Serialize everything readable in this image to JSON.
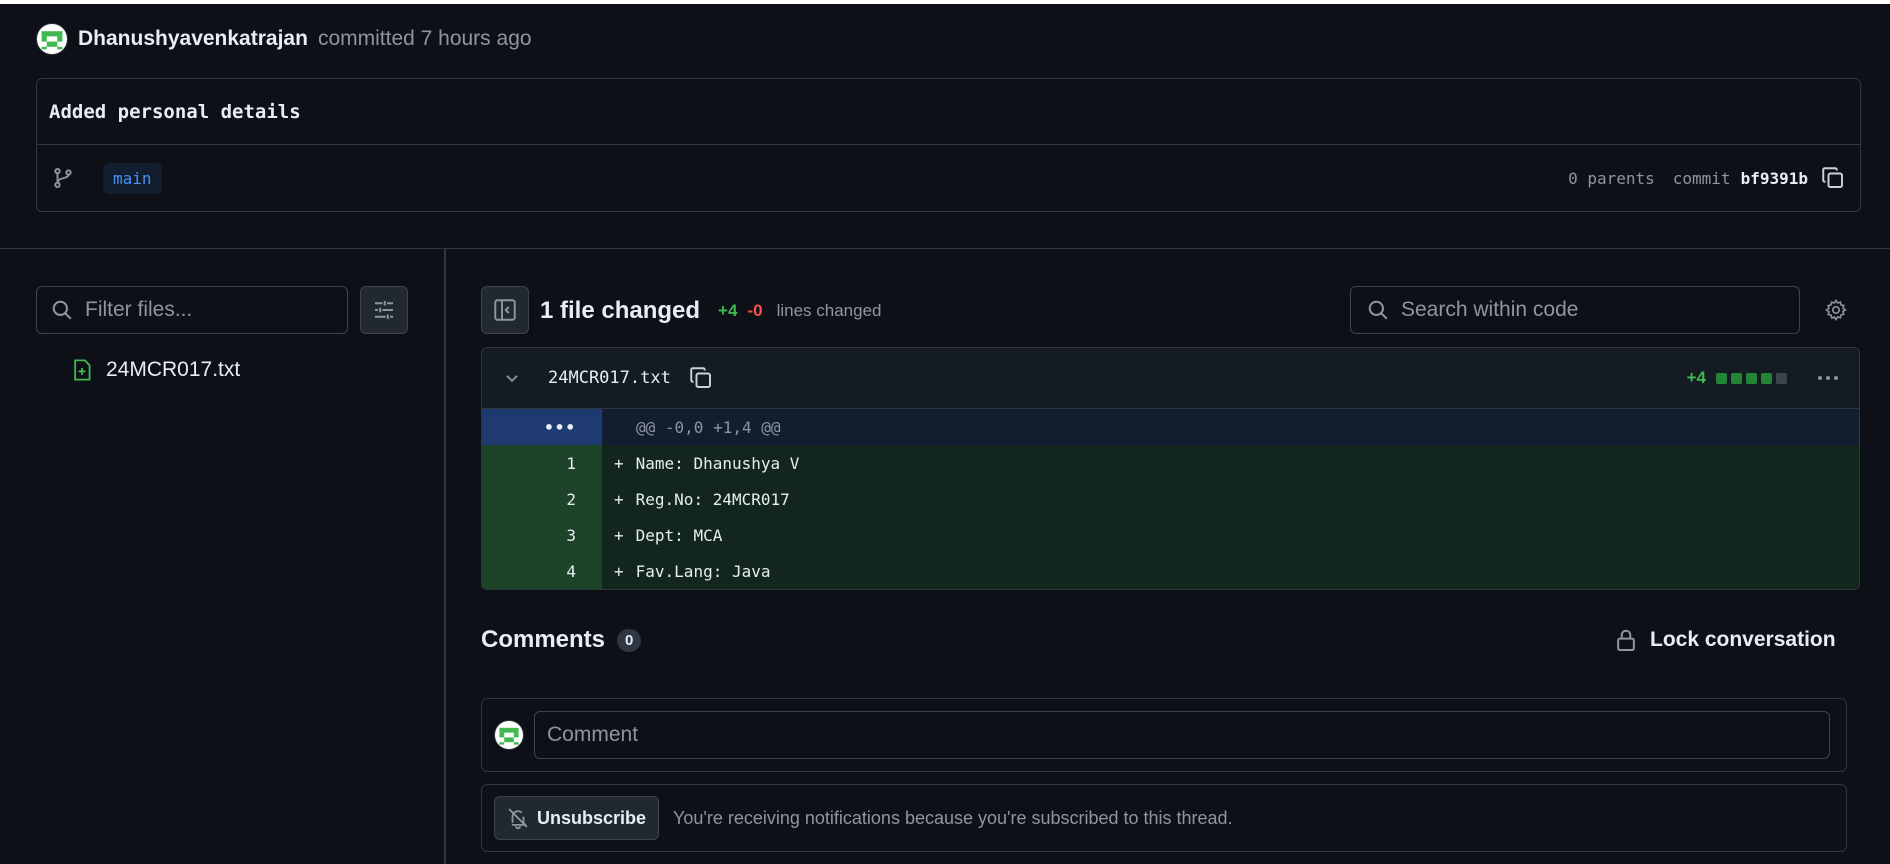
{
  "commit": {
    "author": "Dhanushyavenkatrajan",
    "meta": "committed 7 hours ago",
    "message": "Added personal details",
    "branch": "main",
    "parents": "0 parents",
    "commit_label": "commit",
    "sha": "bf9391b"
  },
  "sidebar": {
    "filter_placeholder": "Filter files...",
    "files": [
      {
        "name": "24MCR017.txt",
        "status": "added"
      }
    ]
  },
  "summary": {
    "files_changed": "1 file changed",
    "additions": "+4",
    "deletions": "-0",
    "lines_changed": "lines changed",
    "search_placeholder": "Search within code"
  },
  "diff": {
    "filename": "24MCR017.txt",
    "stat_additions": "+4",
    "hunk_marker": "•••",
    "hunk": "@@ -0,0 +1,4 @@",
    "lines": [
      {
        "num": "1",
        "sign": "+",
        "text": "Name: Dhanushya V"
      },
      {
        "num": "2",
        "sign": "+",
        "text": "Reg.No: 24MCR017"
      },
      {
        "num": "3",
        "sign": "+",
        "text": "Dept: MCA"
      },
      {
        "num": "4",
        "sign": "+",
        "text": "Fav.Lang: Java"
      }
    ]
  },
  "comments": {
    "title": "Comments",
    "count": "0",
    "lock_label": "Lock conversation",
    "input_placeholder": "Comment",
    "unsubscribe_label": "Unsubscribe",
    "notification_text": "You're receiving notifications because you're subscribed to this thread."
  },
  "icons": {
    "avatar": "identicon-avatar",
    "branch": "git-branch-icon",
    "copy": "copy-icon",
    "search": "search-icon",
    "settings": "sliders-icon",
    "file_added": "file-added-icon",
    "sidebar_toggle": "sidebar-toggle-icon",
    "gear": "gear-icon",
    "chevron": "chevron-down-icon",
    "kebab": "kebab-horizontal-icon",
    "lock": "lock-icon",
    "bell_slash": "bell-slash-icon"
  },
  "colors": {
    "background": "#0d1117",
    "border": "#30363d",
    "addition": "#3fb950",
    "deletion": "#f85149",
    "accent": "#4493f8"
  }
}
